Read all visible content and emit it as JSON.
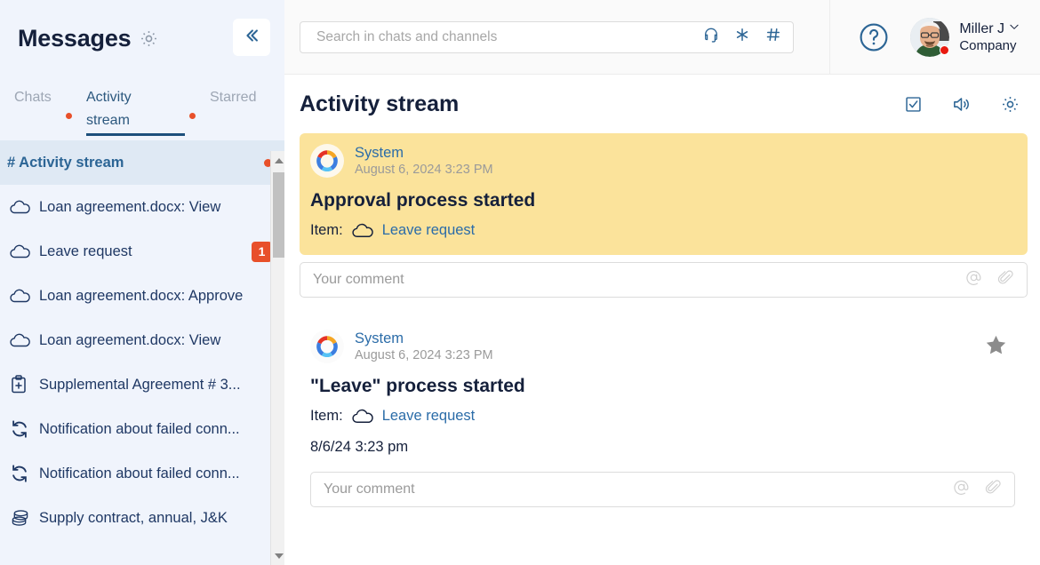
{
  "sidebar": {
    "title": "Messages",
    "settings_icon": "gear-icon",
    "collapse_icon": "double-chevron-left-icon",
    "tabs": [
      {
        "label": "Chats",
        "active": false,
        "has_dot": true
      },
      {
        "label": "Activity stream",
        "active": true,
        "has_dot": false
      },
      {
        "label": "Starred",
        "active": false,
        "has_dot": true
      }
    ],
    "items": [
      {
        "label": "# Activity stream",
        "icon": "hash-icon",
        "active": true,
        "dot": true,
        "badge": ""
      },
      {
        "label": "Loan agreement.docx: View",
        "icon": "cloud-icon",
        "active": false,
        "dot": false,
        "badge": ""
      },
      {
        "label": "Leave request",
        "icon": "cloud-icon",
        "active": false,
        "dot": false,
        "badge": "1"
      },
      {
        "label": "Loan agreement.docx: Approve",
        "icon": "cloud-icon",
        "active": false,
        "dot": false,
        "badge": ""
      },
      {
        "label": "Loan agreement.docx: View",
        "icon": "cloud-icon",
        "active": false,
        "dot": false,
        "badge": ""
      },
      {
        "label": "Supplemental Agreement # 3...",
        "icon": "clipboard-plus-icon",
        "active": false,
        "dot": false,
        "badge": ""
      },
      {
        "label": "Notification about failed conn...",
        "icon": "sync-icon",
        "active": false,
        "dot": false,
        "badge": ""
      },
      {
        "label": "Notification about failed conn...",
        "icon": "sync-icon",
        "active": false,
        "dot": false,
        "badge": ""
      },
      {
        "label": "Supply contract, annual, J&K",
        "icon": "database-icon",
        "active": false,
        "dot": false,
        "badge": ""
      }
    ]
  },
  "topbar": {
    "search": {
      "placeholder": "Search in chats and channels",
      "value": "",
      "icons": [
        "headset-icon",
        "asterisk-icon",
        "hash-icon"
      ]
    },
    "help_icon": "question-circle-icon",
    "user": {
      "name": "Miller J",
      "org": "Company",
      "status": "busy",
      "chevron": "chevron-down-icon"
    }
  },
  "content": {
    "title": "Activity stream",
    "header_icons": [
      "checkbox-checked-icon",
      "sound-on-icon",
      "gear-icon"
    ],
    "messages": [
      {
        "author": "System",
        "timestamp": "August 6, 2024 3:23 PM",
        "title": "Approval process started",
        "item_label": "Item:",
        "item_link": "Leave request",
        "date_line": "",
        "starred": false,
        "highlighted": true,
        "comment_placeholder": "Your comment",
        "comment_value": ""
      },
      {
        "author": "System",
        "timestamp": "August 6, 2024 3:23 PM",
        "title": "\"Leave\" process started",
        "item_label": "Item:",
        "item_link": "Leave request",
        "date_line": "8/6/24 3:23 pm",
        "starred": true,
        "highlighted": false,
        "comment_placeholder": "Your comment",
        "comment_value": ""
      }
    ]
  },
  "colors": {
    "accent_blue": "#2B6CA8",
    "dark_navy": "#15203B",
    "alert_red": "#E8502A",
    "highlight_yellow": "#FBE39B",
    "sidebar_bg": "#F0F4FC",
    "active_item_bg": "#DFE9F4"
  }
}
